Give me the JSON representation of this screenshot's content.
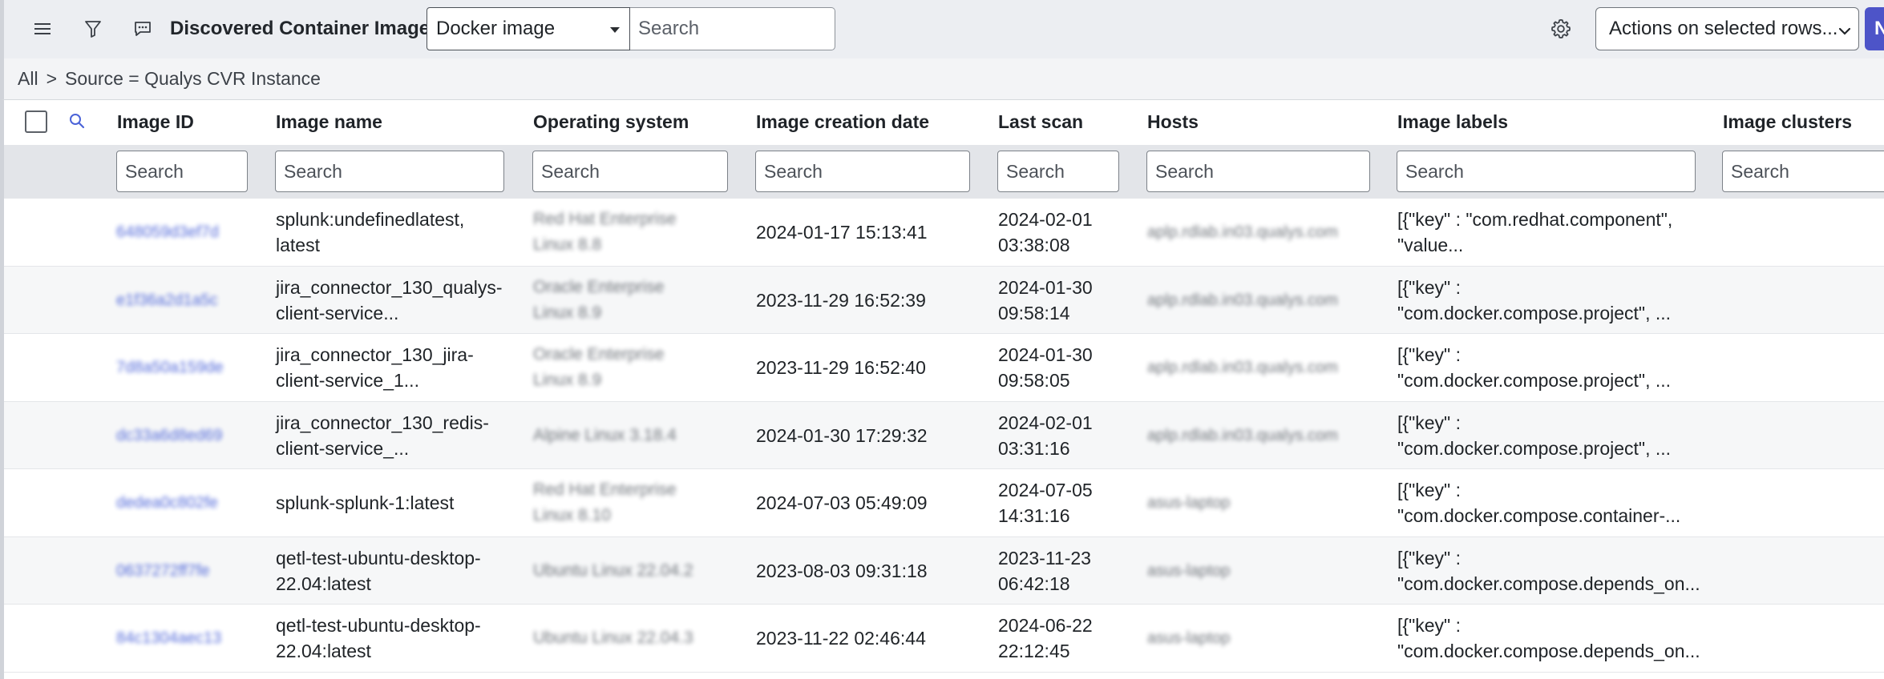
{
  "header": {
    "title": "Discovered Container Images",
    "field_selected": "Docker image",
    "search_placeholder": "Search",
    "actions_label": "Actions on selected rows...",
    "new_label": "N"
  },
  "breadcrumb": {
    "root": "All",
    "separator": ">",
    "filter": "Source = Qualys CVR Instance"
  },
  "columns": [
    {
      "label": "Image ID"
    },
    {
      "label": "Image name"
    },
    {
      "label": "Operating system"
    },
    {
      "label": "Image creation date"
    },
    {
      "label": "Last scan"
    },
    {
      "label": "Hosts"
    },
    {
      "label": "Image labels"
    },
    {
      "label": "Image clusters"
    }
  ],
  "filter_placeholder": "Search",
  "rows": [
    {
      "image_id": "648059d3ef7d",
      "name_1": "splunk:undefinedlatest,",
      "name_2": "latest",
      "os_1": "Red Hat Enterprise",
      "os_2": "Linux 8.8",
      "created": "2024-01-17 15:13:41",
      "scan_1": "2024-02-01",
      "scan_2": "03:38:08",
      "hosts": "aplp.rdlab.in03.qualys.com",
      "labels_1": "[{\"key\" : \"com.redhat.component\",",
      "labels_2": "\"value..."
    },
    {
      "image_id": "e1f36a2d1a5c",
      "name_1": "jira_connector_130_qualys-",
      "name_2": "client-service...",
      "os_1": "Oracle Enterprise",
      "os_2": "Linux 8.9",
      "created": "2023-11-29 16:52:39",
      "scan_1": "2024-01-30",
      "scan_2": "09:58:14",
      "hosts": "aplp.rdlab.in03.qualys.com",
      "labels_1": "[{\"key\" :",
      "labels_2": "\"com.docker.compose.project\", ..."
    },
    {
      "image_id": "7d8a50a159de",
      "name_1": "jira_connector_130_jira-",
      "name_2": "client-service_1...",
      "os_1": "Oracle Enterprise",
      "os_2": "Linux 8.9",
      "created": "2023-11-29 16:52:40",
      "scan_1": "2024-01-30",
      "scan_2": "09:58:05",
      "hosts": "aplp.rdlab.in03.qualys.com",
      "labels_1": "[{\"key\" :",
      "labels_2": "\"com.docker.compose.project\", ..."
    },
    {
      "image_id": "dc33a6d8ed69",
      "name_1": "jira_connector_130_redis-",
      "name_2": "client-service_...",
      "os_1": "Alpine Linux 3.18.4",
      "os_2": "",
      "created": "2024-01-30 17:29:32",
      "scan_1": "2024-02-01",
      "scan_2": "03:31:16",
      "hosts": "aplp.rdlab.in03.qualys.com",
      "labels_1": "[{\"key\" :",
      "labels_2": "\"com.docker.compose.project\", ..."
    },
    {
      "image_id": "dedea0c802fe",
      "name_1": "splunk-splunk-1:latest",
      "name_2": "",
      "os_1": "Red Hat Enterprise",
      "os_2": "Linux 8.10",
      "created": "2024-07-03 05:49:09",
      "scan_1": "2024-07-05",
      "scan_2": "14:31:16",
      "hosts": "asus-laptop",
      "labels_1": "[{\"key\" :",
      "labels_2": "\"com.docker.compose.container-..."
    },
    {
      "image_id": "0637272ff7fe",
      "name_1": "qetl-test-ubuntu-desktop-",
      "name_2": "22.04:latest",
      "os_1": "Ubuntu Linux 22.04.2",
      "os_2": "",
      "created": "2023-08-03 09:31:18",
      "scan_1": "2023-11-23",
      "scan_2": "06:42:18",
      "hosts": "asus-laptop",
      "labels_1": "[{\"key\" :",
      "labels_2": "\"com.docker.compose.depends_on..."
    },
    {
      "image_id": "84c1304aec13",
      "name_1": "qetl-test-ubuntu-desktop-",
      "name_2": "22.04:latest",
      "os_1": "Ubuntu Linux 22.04.3",
      "os_2": "",
      "created": "2023-11-22 02:46:44",
      "scan_1": "2024-06-22",
      "scan_2": "22:12:45",
      "hosts": "asus-laptop",
      "labels_1": "[{\"key\" :",
      "labels_2": "\"com.docker.compose.depends_on..."
    }
  ],
  "icons": {
    "menu": "hamburger-menu-icon",
    "filter": "funnel-filter-icon",
    "chat": "chat-bubble-icon",
    "settings": "gear-icon",
    "column_search": "magnifier-search-icon"
  },
  "colors": {
    "accent": "#4d54c8",
    "link": "#4b63d8",
    "header_bg": "#eceef2",
    "filter_row_bg": "#e3e5e9"
  }
}
